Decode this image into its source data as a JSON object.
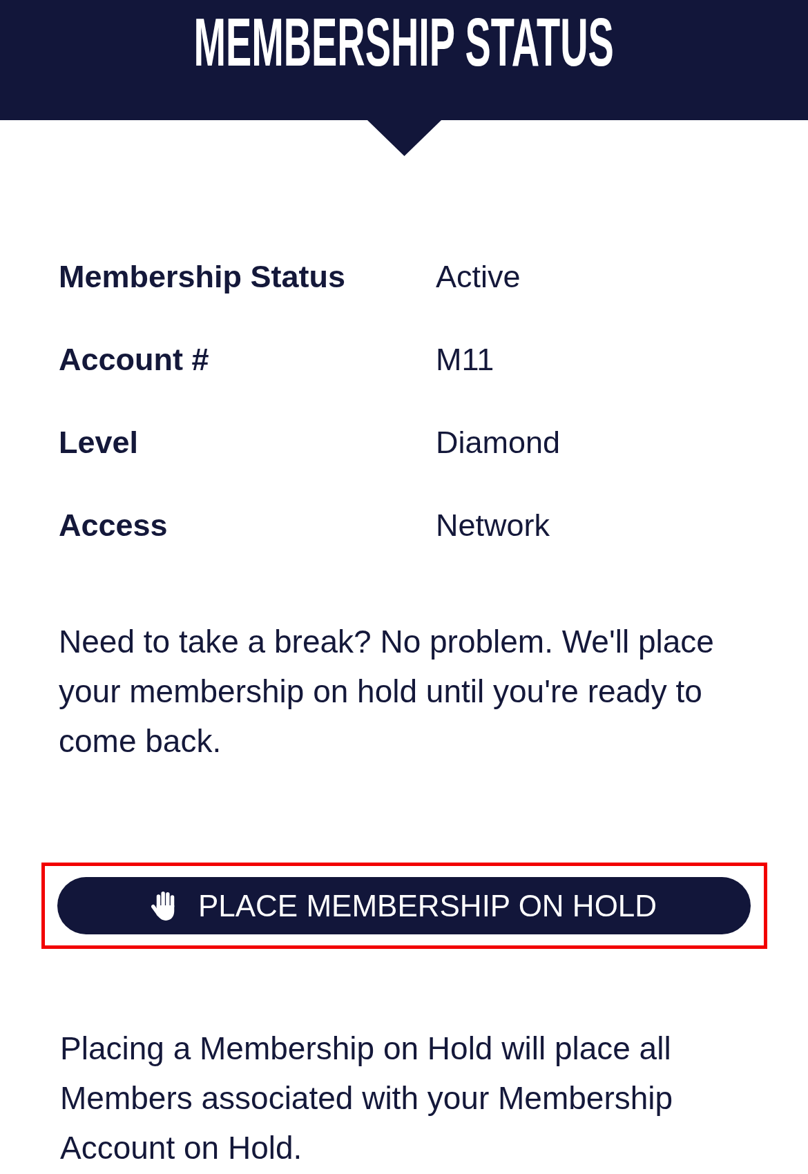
{
  "header": {
    "title": "MEMBERSHIP STATUS"
  },
  "details": [
    {
      "label": "Membership Status",
      "value": "Active"
    },
    {
      "label": "Account #",
      "value": "M11"
    },
    {
      "label": "Level",
      "value": "Diamond"
    },
    {
      "label": "Access",
      "value": "Network"
    }
  ],
  "intro": "Need to take a break? No problem. We'll place your membership on hold until you're ready to come back.",
  "hold_button": {
    "label": "PLACE MEMBERSHIP ON HOLD",
    "highlighted": true
  },
  "note": "Placing a Membership on Hold will place all Members associated with your Membership Account on Hold."
}
